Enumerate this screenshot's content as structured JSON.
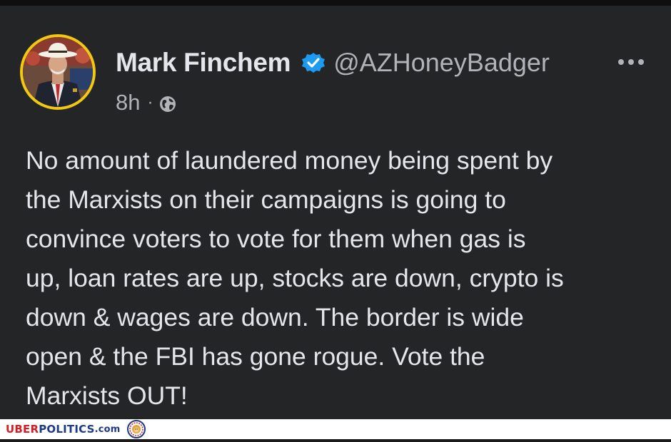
{
  "post": {
    "author_name": "Mark Finchem",
    "handle": "@AZHoneyBadger",
    "verified_icon": "verified-badge-icon",
    "time": "8h",
    "separator": "·",
    "audience_icon": "globe-icon",
    "more_icon": "more-options-icon",
    "text": "No amount of laundered money being spent by\nthe Marxists on their campaigns is going to\nconvince voters to vote for them when gas is\nup, loan rates are up, stocks are down, crypto is\ndown & wages are down. The border is wide\nopen & the FBI has gone rogue. Vote the\nMarxists OUT!"
  },
  "watermark": {
    "part1": "UBER",
    "part2": "POLITICS",
    "part3": ".com"
  },
  "colors": {
    "background": "#242526",
    "text_primary": "#e4e6eb",
    "text_secondary": "#b0b3b8",
    "verified_blue": "#1d9bf0",
    "avatar_ring": "#f2c811",
    "watermark_red": "#d41e25",
    "watermark_blue": "#1d3a8a"
  }
}
